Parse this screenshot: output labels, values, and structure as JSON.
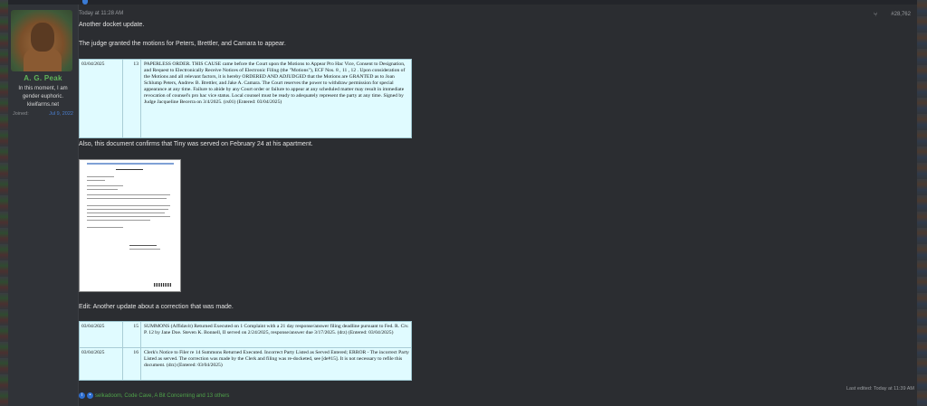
{
  "user": {
    "name": "A. G. Peak",
    "title": "In this moment, I am gender euphoric. kiwifarms.net",
    "joined_label": "Joined:",
    "joined_date": "Jul 9, 2022"
  },
  "post": {
    "timestamp": "Today at 11:28 AM",
    "number": "#28,762",
    "paragraph1": "Another docket update.",
    "paragraph2": "The judge granted the motions for Peters, Brettler, and Camara to appear.",
    "paragraph3": "Also, this document confirms that Tiny was served on February 24 at his apartment.",
    "paragraph4": "Edit: Another update about a correction that was made.",
    "last_edited": "Last edited: Today at 11:39 AM"
  },
  "docket1": {
    "date": "03/04/2025",
    "num": "13",
    "text": "PAPERLESS ORDER. THIS CAUSE came before the Court upon the Motions to Appear Pro Hac Vice, Consent to Designation, and Request to Electronically Receive Notices of Electronic Filing (the \"Motions\"), ECF Nos. 8 , 11 , 12 . Upon consideration of the Motions and all relevant factors, it is hereby ORDERED AND ADJUDGED that the Motions are GRANTED as to Joan Schlump Peters, Andrew B. Brettler, and Jake A. Camara. The Court reserves the power to withdraw permission for special appearance at any time. Failure to abide by any Court order or failure to appear at any scheduled matter may result in immediate revocation of counsel's pro hac vice status. Local counsel must be ready to adequately represent the party at any time. Signed by Judge Jacqueline Becerra on 3/4/2025. (rs01) (Entered: 03/04/2025)"
  },
  "docket2": {
    "rows": [
      {
        "date": "03/04/2025",
        "num": "15",
        "text": "SUMMONS (Affidavit) Returned Executed on 1 Complaint with a 21 day response/answer filing deadline pursuant to Fed. R. Civ. P. 12 by Jane Doe. Steven K. Bonnell, II served on 2/24/2025, response/answer due 3/17/2025. (drz) (Entered: 03/04/2025)"
      },
      {
        "date": "03/04/2025",
        "num": "16",
        "text": "Clerk's Notice to Filer re 14 Summons Returned Executed. Incorrect Party Listed as Served Entered; ERROR - The incorrect Party Listed as served. The correction was made by the Clerk and filing was re-docketed, see [de#15]. It is not necessary to refile this document. (drz) (Entered: 03/04/2025)"
      }
    ]
  },
  "reactions": {
    "text": "selkadoom, Code Cave, A Bit Concerning and 13 others"
  },
  "icons": {
    "share": "share-icon",
    "reaction_info": "info-icon",
    "reaction_like": "like-icon",
    "doc_link": "document-link-icon"
  },
  "colors": {
    "username": "#5fb45a",
    "link": "#4a7fd0",
    "docket_bg": "#e0fbff",
    "page_bg": "#2b2d31"
  }
}
